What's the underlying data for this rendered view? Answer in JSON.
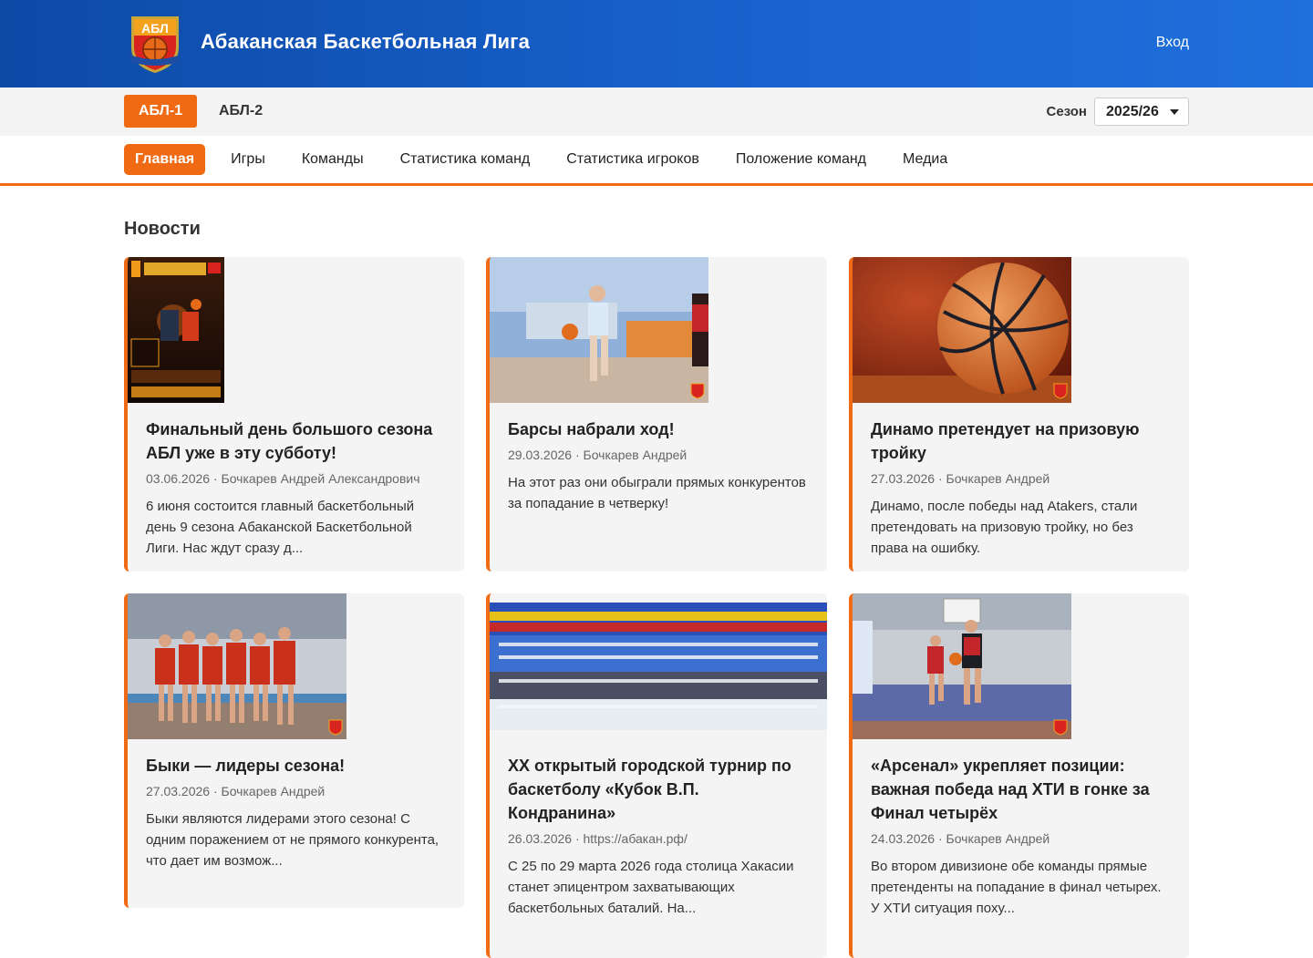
{
  "header": {
    "title": "Абаканская Баскетбольная Лига",
    "login_label": "Вход",
    "logo_text": "АБЛ"
  },
  "league_bar": {
    "tabs": [
      {
        "label": "АБЛ-1",
        "active": true
      },
      {
        "label": "АБЛ-2",
        "active": false
      }
    ],
    "season_label": "Сезон",
    "season_value": "2025/26"
  },
  "nav": {
    "items": [
      {
        "label": "Главная",
        "active": true
      },
      {
        "label": "Игры"
      },
      {
        "label": "Команды"
      },
      {
        "label": "Статистика команд"
      },
      {
        "label": "Статистика игроков"
      },
      {
        "label": "Положение команд"
      },
      {
        "label": "Медиа"
      }
    ]
  },
  "news": {
    "section_title": "Новости",
    "items": [
      {
        "title": "Финальный день большого сезона АБЛ уже в эту субботу!",
        "meta": "03.06.2026 · Бочкарев Андрей Александрович",
        "text": "6 июня состоится главный баскетбольный день 9 сезона Абаканской Баскетбольной Лиги. Нас ждут сразу д..."
      },
      {
        "title": "Барсы набрали ход!",
        "meta": "29.03.2026 · Бочкарев Андрей",
        "text": "На этот раз они обыграли прямых конкурентов за попадание в четверку!"
      },
      {
        "title": "Динамо претендует на призовую тройку",
        "meta": "27.03.2026 · Бочкарев Андрей",
        "text": "Динамо, после победы над Atakers, стали претендовать на призовую тройку, но без права на ошибку."
      },
      {
        "title": "Быки — лидеры сезона!",
        "meta": "27.03.2026 · Бочкарев Андрей",
        "text": "Быки являются лидерами этого сезона! С одним поражением от не прямого конкурента, что дает им возмож..."
      },
      {
        "title": "XX открытый городской турнир по баскетболу «Кубок В.П. Кондранина»",
        "meta": "26.03.2026 · https://абакан.рф/",
        "text": "С 25 по 29 марта 2026 года столица Хакасии станет эпицентром захватывающих баскетбольных баталий. На..."
      },
      {
        "title": "«Арсенал» укрепляет позиции: важная победа над ХТИ в гонке за Финал четырёх",
        "meta": "24.03.2026 · Бочкарев Андрей",
        "text": "Во втором дивизионе обе команды прямые претенденты на попадание в финал четырех. У ХТИ ситуация поху..."
      }
    ]
  },
  "colors": {
    "header_blue": "#1a63cf",
    "accent_orange": "#ef6a12",
    "card_bg": "#f4f4f4"
  }
}
